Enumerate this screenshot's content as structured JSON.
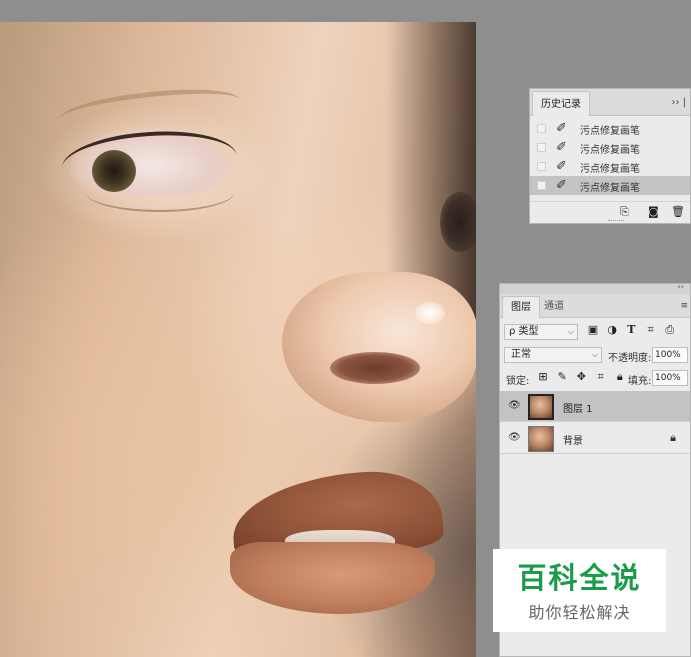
{
  "history_panel": {
    "tab_label": "历史记录",
    "menu_glyph": "›› |",
    "items": [
      {
        "label": "污点修复画笔",
        "active": false
      },
      {
        "label": "污点修复画笔",
        "active": false
      },
      {
        "label": "污点修复画笔",
        "active": false
      },
      {
        "label": "污点修复画笔",
        "active": true
      }
    ],
    "tool_icon": "healing-brush-icon",
    "footer_icons": [
      "new-document-from-state-icon",
      "camera-snapshot-icon",
      "trash-icon"
    ]
  },
  "layers_panel": {
    "collapse_glyph": "‹‹",
    "tabs": [
      {
        "label": "图层"
      },
      {
        "label": "通道"
      }
    ],
    "menu_glyph": "≡",
    "filter": {
      "value": "ρ 类型"
    },
    "filter_icons": [
      "image-filter-icon",
      "adjustment-filter-icon",
      "type-filter-icon",
      "shape-filter-icon",
      "smart-object-filter-icon"
    ],
    "blend_mode": "正常",
    "opacity_label": "不透明度:",
    "opacity_value": "100%",
    "lock_label": "锁定:",
    "lock_icons": [
      "lock-transparent-icon",
      "lock-paint-icon",
      "lock-move-icon",
      "lock-artboard-icon",
      "lock-all-icon"
    ],
    "fill_label": "填充:",
    "fill_value": "100%",
    "layers": [
      {
        "name": "图层 1",
        "selected": true,
        "locked": false
      },
      {
        "name": "背景",
        "selected": false,
        "locked": true
      }
    ]
  },
  "watermark": {
    "title": "百科全说",
    "subtitle": "助你轻松解决"
  }
}
